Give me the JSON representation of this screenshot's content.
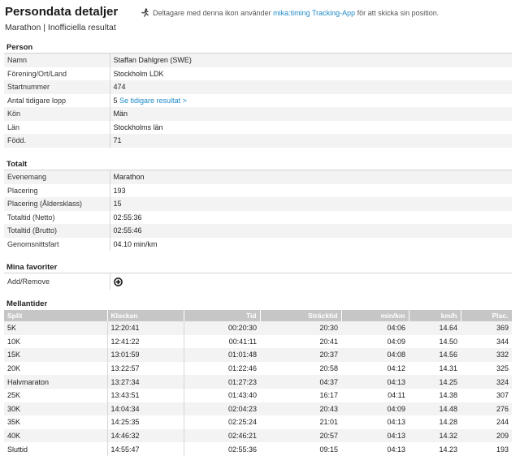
{
  "header": {
    "title": "Persondata detaljer",
    "tracking_prefix": "Deltagare med denna ikon använder ",
    "tracking_app": "mika:timing Tracking-App",
    "tracking_suffix": " för att skicka sin position.",
    "subtitle": "Marathon | Inofficiella resultat"
  },
  "person": {
    "title": "Person",
    "rows": [
      {
        "label": "Namn",
        "value": "Staffan Dahlgren (SWE)"
      },
      {
        "label": "Förening/Ort/Land",
        "value": "Stockholm LDK"
      },
      {
        "label": "Startnummer",
        "value": "474"
      },
      {
        "label": "Antal tidigare lopp",
        "value": "5",
        "link": "Se tidigare resultat >"
      },
      {
        "label": "Kön",
        "value": "Män"
      },
      {
        "label": "Län",
        "value": "Stockholms län"
      },
      {
        "label": "Född.",
        "value": "71"
      }
    ]
  },
  "totalt": {
    "title": "Totalt",
    "rows": [
      {
        "label": "Evenemang",
        "value": "Marathon"
      },
      {
        "label": "Placering",
        "value": "193"
      },
      {
        "label": "Placering (Åldersklass)",
        "value": "15"
      },
      {
        "label": "Totaltid (Netto)",
        "value": "02:55:36"
      },
      {
        "label": "Totaltid (Brutto)",
        "value": "02:55:46"
      },
      {
        "label": "Genomsnittsfart",
        "value": "04.10 min/km"
      }
    ]
  },
  "favorites": {
    "title": "Mina favoriter",
    "label": "Add/Remove",
    "icon": "plus-circle-icon"
  },
  "splits": {
    "title": "Mellantider",
    "columns": [
      "Split",
      "Klockan",
      "Tid",
      "Sträcktid",
      "min/km",
      "km/h",
      "Plac."
    ],
    "rows": [
      [
        "5K",
        "12:20:41",
        "00:20:30",
        "20:30",
        "04:06",
        "14.64",
        "369"
      ],
      [
        "10K",
        "12:41:22",
        "00:41:11",
        "20:41",
        "04:09",
        "14.50",
        "344"
      ],
      [
        "15K",
        "13:01:59",
        "01:01:48",
        "20:37",
        "04:08",
        "14.56",
        "332"
      ],
      [
        "20K",
        "13:22:57",
        "01:22:46",
        "20:58",
        "04:12",
        "14.31",
        "325"
      ],
      [
        "Halvmaraton",
        "13:27:34",
        "01:27:23",
        "04:37",
        "04:13",
        "14.25",
        "324"
      ],
      [
        "25K",
        "13:43:51",
        "01:43:40",
        "16:17",
        "04:11",
        "14.38",
        "307"
      ],
      [
        "30K",
        "14:04:34",
        "02:04:23",
        "20:43",
        "04:09",
        "14.48",
        "276"
      ],
      [
        "35K",
        "14:25:35",
        "02:25:24",
        "21:01",
        "04:13",
        "14.28",
        "244"
      ],
      [
        "40K",
        "14:46:32",
        "02:46:21",
        "20:57",
        "04:13",
        "14.32",
        "209"
      ],
      [
        "Sluttid",
        "14:55:47",
        "02:55:36",
        "09:15",
        "04:13",
        "14.23",
        "193"
      ]
    ]
  },
  "colors": {
    "link": "#1e8ac8",
    "header_bg": "#c6c6c6",
    "row_alt": "#f3f3f3"
  }
}
